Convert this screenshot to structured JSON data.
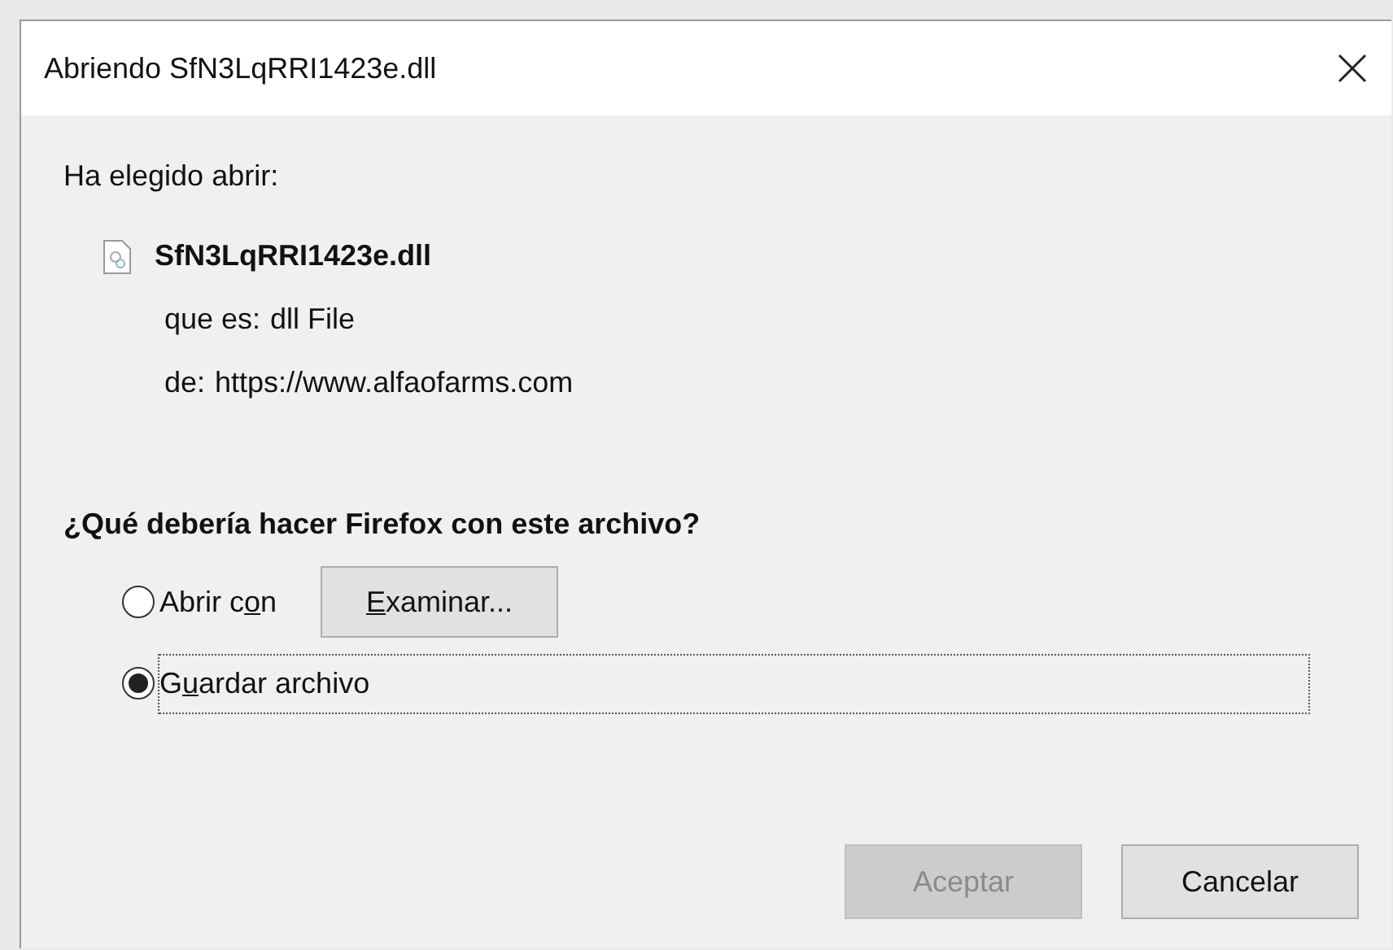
{
  "window": {
    "title": "Abriendo SfN3LqRRI1423e.dll"
  },
  "intro": "Ha elegido abrir:",
  "file": {
    "name": "SfN3LqRRI1423e.dll",
    "type_label": "que es:",
    "type": "dll File",
    "from_label": "de:",
    "from": "https://www.alfaofarms.com"
  },
  "question": "¿Qué debería hacer Firefox con este archivo?",
  "options": [
    {
      "label": [
        {
          "text": "Abrir c",
          "underlined": false
        },
        {
          "text": "o",
          "underlined": true
        },
        {
          "text": "n",
          "underlined": false
        }
      ],
      "selected": false,
      "focused": false,
      "button": {
        "label": [
          {
            "text": "E",
            "underlined": true
          },
          {
            "text": "xaminar...",
            "underlined": false
          }
        ]
      }
    },
    {
      "label": [
        {
          "text": "G",
          "underlined": false
        },
        {
          "text": "u",
          "underlined": true
        },
        {
          "text": "ardar archivo",
          "underlined": false
        }
      ],
      "selected": true,
      "focused": true
    }
  ],
  "buttons": [
    {
      "label": "Aceptar",
      "disabled": true
    },
    {
      "label": "Cancelar",
      "disabled": false
    }
  ]
}
